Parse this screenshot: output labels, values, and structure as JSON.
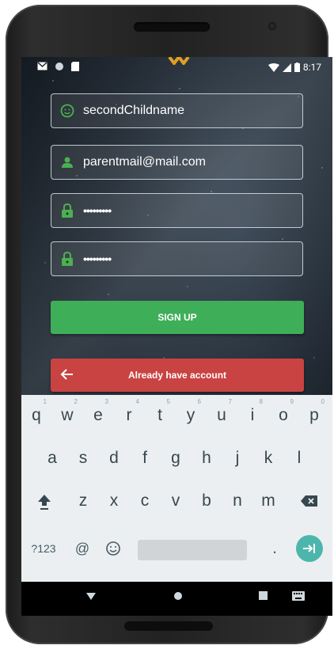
{
  "status_bar": {
    "time": "8:17",
    "icons": [
      "gmail-icon",
      "sync-icon",
      "sd-card-icon",
      "wifi-icon",
      "signal-icon",
      "battery-icon"
    ]
  },
  "form": {
    "child_name": {
      "value": "secondChildname",
      "icon": "child-face-icon"
    },
    "email": {
      "value": "parentmail@mail.com",
      "icon": "person-icon"
    },
    "password": {
      "value": "•••••••••",
      "icon": "lock-icon"
    },
    "confirm_password": {
      "value": "•••••••••",
      "icon": "lock-icon"
    }
  },
  "buttons": {
    "signup_label": "SIGN UP",
    "login_label": "Already have account"
  },
  "keyboard": {
    "row1": [
      "q",
      "w",
      "e",
      "r",
      "t",
      "y",
      "u",
      "i",
      "o",
      "p"
    ],
    "row1_hints": [
      "1",
      "2",
      "3",
      "4",
      "5",
      "6",
      "7",
      "8",
      "9",
      "0"
    ],
    "row2": [
      "a",
      "s",
      "d",
      "f",
      "g",
      "h",
      "j",
      "k",
      "l"
    ],
    "row3": [
      "z",
      "x",
      "c",
      "v",
      "b",
      "n",
      "m"
    ],
    "symbols_label": "?123",
    "at_label": "@",
    "period_label": "."
  },
  "colors": {
    "accent_green": "#3fae58",
    "accent_red": "#c94343",
    "input_icon_green": "#4caf50",
    "enter_teal": "#4db6ac"
  }
}
